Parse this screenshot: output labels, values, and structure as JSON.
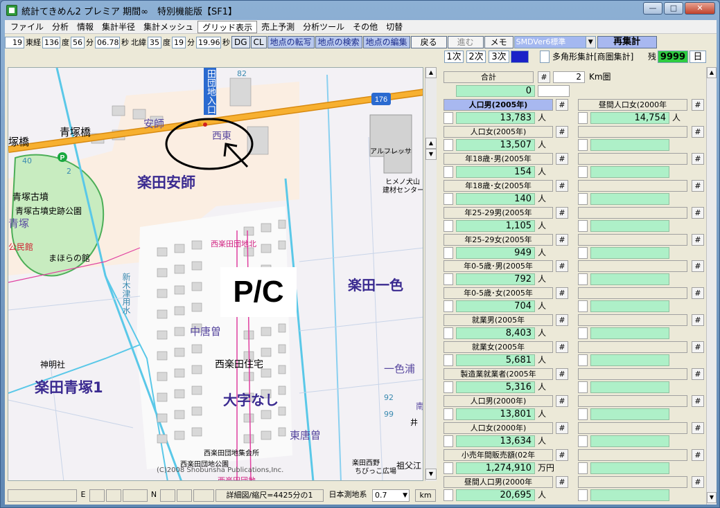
{
  "window": {
    "title": "統計てきめん2 プレミア 期間∞　特別機能版【SF1】",
    "btn_min": "—",
    "btn_max": "□",
    "btn_close": "✕"
  },
  "menu": [
    "ファイル",
    "分析",
    "情報",
    "集計半径",
    "集計メッシュ",
    "グリッド表示",
    "売上予測",
    "分析ツール",
    "その他",
    "切替"
  ],
  "coords": {
    "lon_deg_val": "19",
    "lon_label": "東経",
    "lon_deg": "136",
    "deg_label": "度",
    "lon_min": "56",
    "min_label": "分",
    "lon_sec": "06.78",
    "sec_label": "秒",
    "lat_label": "北緯",
    "lat_deg": "35",
    "lat_deg_label": "度",
    "lat_min": "19",
    "lat_min_label": "分",
    "lat_sec": "19.96",
    "lat_sec_label": "秒"
  },
  "toolbar": {
    "dg": "DG",
    "cl": "CL",
    "transfer": "地点の転写",
    "search": "地点の検索",
    "edit": "地点の編集",
    "back": "戻る",
    "forward": "進む",
    "memo": "メモ",
    "version": "SMDVer6標準",
    "recalc": "再集計"
  },
  "toolbar2": {
    "primary": "1次",
    "secondary": "2次",
    "tertiary": "3次",
    "polygon_label": "多角形集計[商圏集計]",
    "remain_label": "残",
    "remain_value": "9999",
    "day": "日"
  },
  "map": {
    "labels": {
      "tsukabashi": "塚橋",
      "aotsukabashi": "青塚橋",
      "anshi": "安師",
      "nishi": "西東",
      "rakuden_anshi": "楽田安師",
      "aotsuka_kofun": "青塚古墳",
      "aotsuka_park": "青塚古墳史跡公園",
      "aotsuka": "青塚",
      "kominkan": "公民館",
      "mahoranokan": "まほらの館",
      "alfresa": "アルフレッサ",
      "hemu_inuyama": "ヒメノ犬山",
      "kenzai": "建材センター",
      "danchi_kita": "西楽田団地北",
      "shinkitsu": "新木津用水",
      "rakuden_isshiki": "楽田一色",
      "chubu": "中唐曽",
      "jinmeisha": "神明社",
      "rakuden_aotsuka1": "楽田青塚1",
      "nishirakuden_jutaku": "西楽田住宅",
      "oaza_nashi": "大字なし",
      "isshiki_ura": "一色浦",
      "higashi_kara": "東唐曽",
      "shukaijo": "西楽田団地集会所",
      "park": "西楽田団地公園",
      "copyright": "(C)2008 Shobunsha Publications,Inc.",
      "nishidanchi": "西楽田団地",
      "rakuden_nishino": "楽田西野",
      "chibikko": "ちびっこ広場",
      "sofu": "祖父江",
      "dan_chi_entrance": "田団地入口",
      "route": "176",
      "pc_badge": "P/C",
      "p_icon": "P",
      "num_82": "82",
      "num_40": "40",
      "num_2": "2",
      "num_92": "92",
      "num_99": "99",
      "num_i": "井",
      "kanji_nan": "南"
    }
  },
  "panel": {
    "total_label": "合計",
    "radius_value": "2",
    "radius_unit": "Km圏",
    "total_value": "0",
    "rows": [
      {
        "left_label": "人口男(2005年)",
        "left_value": "13,783",
        "left_unit": "人",
        "right_label": "昼間人口女(2000年",
        "right_value": "14,754",
        "right_unit": "人",
        "selected": true
      },
      {
        "left_label": "人口女(2005年)",
        "left_value": "13,507",
        "left_unit": "人",
        "right_label": "",
        "right_value": "",
        "right_unit": ""
      },
      {
        "left_label": "年18歳･男(2005年",
        "left_value": "154",
        "left_unit": "人",
        "right_label": "",
        "right_value": "",
        "right_unit": ""
      },
      {
        "left_label": "年18歳･女(2005年",
        "left_value": "140",
        "left_unit": "人",
        "right_label": "",
        "right_value": "",
        "right_unit": ""
      },
      {
        "left_label": "年25-29男(2005年",
        "left_value": "1,105",
        "left_unit": "人",
        "right_label": "",
        "right_value": "",
        "right_unit": ""
      },
      {
        "left_label": "年25-29女(2005年",
        "left_value": "949",
        "left_unit": "人",
        "right_label": "",
        "right_value": "",
        "right_unit": ""
      },
      {
        "left_label": "年0-5歳･男(2005年",
        "left_value": "792",
        "left_unit": "人",
        "right_label": "",
        "right_value": "",
        "right_unit": ""
      },
      {
        "left_label": "年0-5歳･女(2005年",
        "left_value": "704",
        "left_unit": "人",
        "right_label": "",
        "right_value": "",
        "right_unit": ""
      },
      {
        "left_label": "就業男(2005年",
        "left_value": "8,403",
        "left_unit": "人",
        "right_label": "",
        "right_value": "",
        "right_unit": ""
      },
      {
        "left_label": "就業女(2005年",
        "left_value": "5,681",
        "left_unit": "人",
        "right_label": "",
        "right_value": "",
        "right_unit": ""
      },
      {
        "left_label": "製造業就業者(2005年",
        "left_value": "5,316",
        "left_unit": "人",
        "right_label": "",
        "right_value": "",
        "right_unit": ""
      },
      {
        "left_label": "人口男(2000年)",
        "left_value": "13,801",
        "left_unit": "人",
        "right_label": "",
        "right_value": "",
        "right_unit": ""
      },
      {
        "left_label": "人口女(2000年)",
        "left_value": "13,634",
        "left_unit": "人",
        "right_label": "",
        "right_value": "",
        "right_unit": ""
      },
      {
        "left_label": "小売年間販売額(02年",
        "left_value": "1,274,910",
        "left_unit": "万円",
        "right_label": "",
        "right_value": "",
        "right_unit": ""
      },
      {
        "left_label": "昼間人口男(2000年",
        "left_value": "20,695",
        "left_unit": "人",
        "right_label": "",
        "right_value": "",
        "right_unit": ""
      }
    ]
  },
  "status": {
    "e_label": "E",
    "n_label": "N",
    "scale": "詳細図/縮尺=4425分の1",
    "datum": "日本測地系",
    "zoom": "0.7",
    "unit": "km"
  },
  "colors": {
    "value_bg": "#aef0c8",
    "selected_header": "#a8b8f0",
    "road": "#f2a21c",
    "remain_bg": "#2ecc40"
  }
}
